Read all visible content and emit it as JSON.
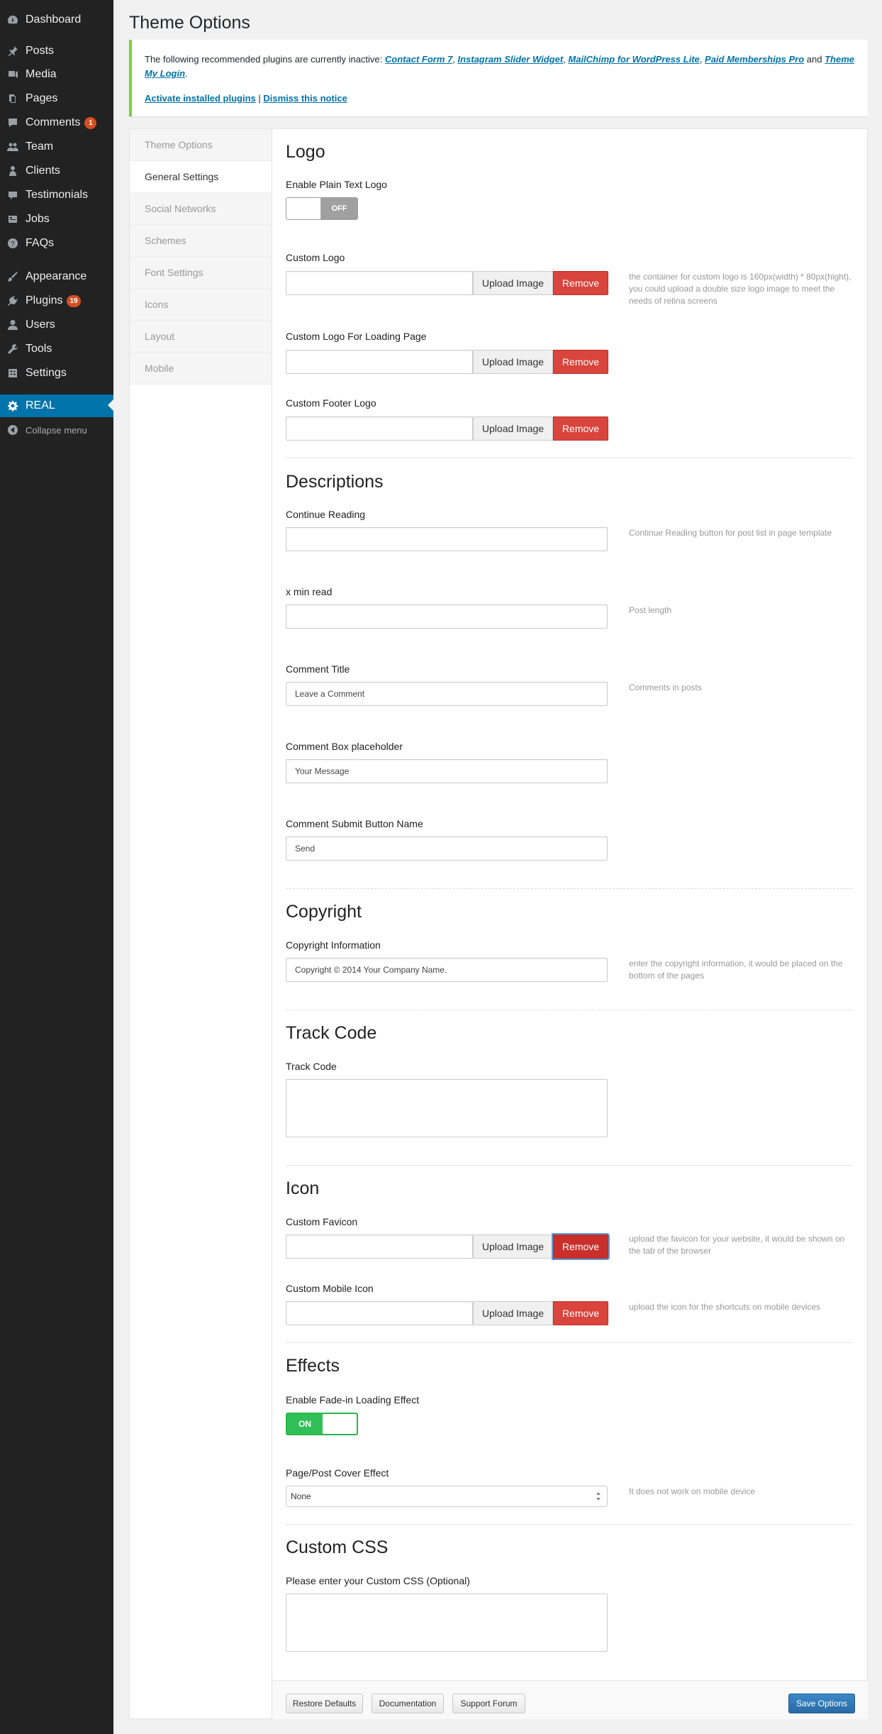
{
  "sidebar": {
    "items": [
      {
        "label": "Dashboard",
        "icon": "dashboard-icon"
      },
      {
        "label": "Posts",
        "icon": "pin-icon"
      },
      {
        "label": "Media",
        "icon": "media-icon"
      },
      {
        "label": "Pages",
        "icon": "pages-icon"
      },
      {
        "label": "Comments",
        "icon": "comment-icon",
        "badge": "1"
      },
      {
        "label": "Team",
        "icon": "team-icon"
      },
      {
        "label": "Clients",
        "icon": "clients-icon"
      },
      {
        "label": "Testimonials",
        "icon": "testimonials-icon"
      },
      {
        "label": "Jobs",
        "icon": "jobs-icon"
      },
      {
        "label": "FAQs",
        "icon": "faq-icon"
      },
      {
        "label": "Appearance",
        "icon": "brush-icon"
      },
      {
        "label": "Plugins",
        "icon": "plugin-icon",
        "badge": "19"
      },
      {
        "label": "Users",
        "icon": "users-icon"
      },
      {
        "label": "Tools",
        "icon": "wrench-icon"
      },
      {
        "label": "Settings",
        "icon": "settings-icon"
      },
      {
        "label": "REAL",
        "icon": "gear-icon",
        "current": true
      },
      {
        "label": "Collapse menu",
        "icon": "collapse-icon"
      }
    ]
  },
  "page": {
    "title": "Theme Options"
  },
  "notice": {
    "text_before": "The following recommended plugins are currently inactive: ",
    "plugin_1": "Contact Form 7",
    "plugin_2": "Instagram Slider Widget",
    "plugin_3": "MailChimp for WordPress Lite",
    "plugin_4": "Paid Memberships Pro",
    "and": " and ",
    "plugin_5": "Theme My Login",
    "period": ".",
    "activate_link": "Activate installed plugins",
    "separator": " | ",
    "dismiss_link": "Dismiss this notice"
  },
  "tabs": [
    "Theme Options",
    "General Settings",
    "Social Networks",
    "Schemes",
    "Font Settings",
    "Icons",
    "Layout",
    "Mobile"
  ],
  "buttons": {
    "upload": "Upload Image",
    "remove": "Remove"
  },
  "logo": {
    "title": "Logo",
    "plain_text_label": "Enable Plain Text Logo",
    "plain_text_state": "OFF",
    "custom_logo_label": "Custom Logo",
    "custom_logo_desc": "the container for custom logo is 160px(width) * 80px(hight), you could upload a double size logo image to meet the needs of retina screens",
    "loading_logo_label": "Custom Logo For Loading Page",
    "footer_logo_label": "Custom Footer Logo"
  },
  "descriptions": {
    "title": "Descriptions",
    "continue_label": "Continue Reading",
    "continue_value": "",
    "continue_desc": "Continue Reading button for post list in page template",
    "min_read_label": "x min read",
    "min_read_value": "",
    "min_read_desc": "Post length",
    "comment_title_label": "Comment Title",
    "comment_title_value": "Leave a Comment",
    "comment_title_desc": "Comments in posts",
    "comment_box_label": "Comment Box placeholder",
    "comment_box_value": "Your Message",
    "submit_label": "Comment Submit Button Name",
    "submit_value": "Send"
  },
  "copyright": {
    "title": "Copyright",
    "label": "Copyright Information",
    "value": "Copyright © 2014 Your Company Name.",
    "desc": "enter the copyright information, it would be placed on the bottom of the pages"
  },
  "track": {
    "title": "Track Code",
    "label": "Track Code"
  },
  "icon": {
    "title": "Icon",
    "favicon_label": "Custom Favicon",
    "favicon_desc": "upload the favicon for your website, it would be shown on the tab of the browser",
    "mobile_label": "Custom Mobile Icon",
    "mobile_desc": "upload the icon for the shortcuts on mobile devices"
  },
  "effects": {
    "title": "Effects",
    "fade_label": "Enable Fade-in Loading Effect",
    "fade_state": "ON",
    "cover_label": "Page/Post Cover Effect",
    "cover_value": "None",
    "cover_desc": "It does not work on mobile device"
  },
  "css": {
    "title": "Custom CSS",
    "label": "Please enter your Custom CSS (Optional)"
  },
  "footer": {
    "restore": "Restore Defaults",
    "docs": "Documentation",
    "forum": "Support Forum",
    "save": "Save Options"
  }
}
